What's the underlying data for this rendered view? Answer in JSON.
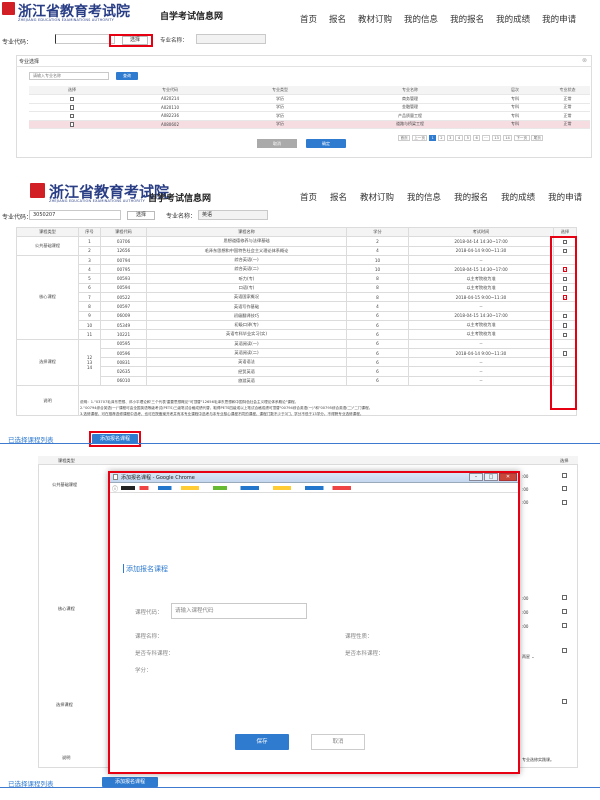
{
  "site": {
    "title": "浙江省教育考试院",
    "subtitle": "ZHEJIANG EDUCATION EXAMINATIONS AUTHORITY",
    "section": "自学考试信息网",
    "nav": [
      "首页",
      "报名",
      "教材订购",
      "我的信息",
      "我的报名",
      "我的成绩",
      "我的申请"
    ]
  },
  "panel1": {
    "major_code_label": "专业代码：",
    "major_code_value": "",
    "choose_btn": "选择",
    "major_name_label": "专业名称：",
    "dialog_title": "专业选择",
    "search_placeholder": "请输入专业名称",
    "search_btn": "查询",
    "headers": [
      "选择",
      "专业代码",
      "专业类型",
      "专业名称",
      "层次",
      "专业状态"
    ],
    "rows": [
      [
        "",
        "A020214",
        "学历",
        "商务管理",
        "专科",
        "正常"
      ],
      [
        "",
        "A020110",
        "学历",
        "金融管理",
        "专科",
        "正常"
      ],
      [
        "",
        "A082236",
        "学历",
        "产品质量工程",
        "专科",
        "正常"
      ],
      [
        "",
        "A080602",
        "学历",
        "道路与桥梁工程",
        "专科",
        "正常"
      ]
    ],
    "pagination": [
      "首页",
      "上一页",
      "1",
      "2",
      "3",
      "4",
      "5",
      "6",
      "···",
      "13",
      "14",
      "下一页",
      "尾页"
    ],
    "cancel_btn": "取消",
    "confirm_btn": "确定"
  },
  "panel2": {
    "major_code_label": "专业代码：",
    "major_code_value": "3050207",
    "choose_btn": "选择",
    "major_name_label": "专业名称：",
    "major_name_value": "英语",
    "headers": [
      "课程类型",
      "序号",
      "课程代码",
      "课程名称",
      "学分",
      "考试时间",
      "选择"
    ],
    "rows": [
      {
        "type": "公共基础课程",
        "seq": "1",
        "code": "03706",
        "name": "思想道德修养与法律基础",
        "credit": "2",
        "time": "2018-04-14 14:30~17:00",
        "sel": "box"
      },
      {
        "type": "",
        "seq": "2",
        "code": "12656",
        "name": "毛泽东思想和中国特色社会主义理论体系概论",
        "credit": "4",
        "time": "2018-04-14 9:00~11:30",
        "sel": "box"
      },
      {
        "type": "",
        "seq": "3",
        "code": "00794",
        "name": "综合英语(一)",
        "credit": "10",
        "time": "--",
        "sel": ""
      },
      {
        "type": "",
        "seq": "4",
        "code": "00795",
        "name": "综合英语(二)",
        "credit": "10",
        "time": "2018-04-15 14:30~17:00",
        "sel": "on"
      },
      {
        "type": "",
        "seq": "5",
        "code": "00593",
        "name": "听力(专)",
        "credit": "8",
        "time": "以主考院校为准",
        "sel": "box"
      },
      {
        "type": "核心课程",
        "seq": "6",
        "code": "00594",
        "name": "口语(专)",
        "credit": "8",
        "time": "以主考院校为准",
        "sel": "box"
      },
      {
        "type": "",
        "seq": "7",
        "code": "00522",
        "name": "英语国家概况",
        "credit": "8",
        "time": "2018-04-15 9:00~11:30",
        "sel": "on"
      },
      {
        "type": "",
        "seq": "8",
        "code": "00597",
        "name": "英语写作基础",
        "credit": "4",
        "time": "--",
        "sel": ""
      },
      {
        "type": "",
        "seq": "9",
        "code": "06009",
        "name": "初级翻译技巧",
        "credit": "6",
        "time": "2018-04-15 14:30~17:00",
        "sel": "box"
      },
      {
        "type": "",
        "seq": "10",
        "code": "05349",
        "name": "初级口译(专)",
        "credit": "6",
        "time": "以主考院校为准",
        "sel": "box"
      },
      {
        "type": "",
        "seq": "11",
        "code": "10221",
        "name": "英语专科毕业实习(实)",
        "credit": "6",
        "time": "以主考院校为准",
        "sel": "box"
      },
      {
        "type": "",
        "seq": "",
        "code": "00595",
        "name": "英语阅读(一)",
        "credit": "6",
        "time": "--",
        "sel": ""
      },
      {
        "type": "",
        "seq": "",
        "code": "00596",
        "name": "英语阅读(二)",
        "credit": "6",
        "time": "2018-04-14 9:00~11:30",
        "sel": "box"
      },
      {
        "type": "选择课程",
        "seq": "",
        "code": "00831",
        "name": "英语语法",
        "credit": "6",
        "time": "--",
        "sel": ""
      },
      {
        "type": "",
        "seq": "",
        "code": "02635",
        "name": "经贸英语",
        "credit": "6",
        "time": "--",
        "sel": ""
      },
      {
        "type": "",
        "seq": "",
        "code": "06010",
        "name": "旅游英语",
        "credit": "6",
        "time": "--",
        "sel": ""
      }
    ],
    "seq_group": "12\n13\n14",
    "note_label": "说明",
    "note_lines": [
      "说明：1.\"03707毛泽东思想、邓小平理论和'三个代表'重要思想概论\"可顶替\"12656毛泽东思想和中国特色社会主义理论体系概论\"课程。",
      "2.\"00794综合英语(一)\"课程可由全国英语等级考试(PETS)三级笔试合格成绩代替，取得PETS四级或以上笔试合格成绩可顶替\"00794综合英语(一)\"和\"00795综合英语(二)\"二门课程。",
      "3.选修课程，可在推荐选修课程中选考，也可在院备案开考并有本专业课程中选考与本专业核心课程不同的课程，课程门数不少于3门，学分不低于13学分。不得跨专业选修课程。"
    ],
    "selected_list": "已选择课程列表",
    "add_btn": "添加报名课程"
  },
  "panel3": {
    "bg_headers": [
      "课程类型",
      "选择"
    ],
    "bg_types": [
      "公共基础课程",
      "核心课程",
      "选择课程",
      "说明"
    ],
    "bg_times": [
      ":00",
      ":00",
      ":00",
      ":00",
      ":00",
      ":00"
    ],
    "bg_note_tail": "专业选修实践课。",
    "bg_select_label": "两星",
    "selected_list": "已选择课程列表",
    "add_btn": "添加报名课程",
    "modal": {
      "window_title": "添加报名课程 - Google Chrome",
      "heading": "添加报名课程",
      "code_label": "课程代码：",
      "code_placeholder": "请输入课程代码",
      "name_label": "课程名称：",
      "nature_label": "课程性质：",
      "specialty_label": "是否专科课程：",
      "undergrad_label": "是否本科课程：",
      "credit_label": "学分：",
      "save_btn": "保存",
      "cancel_btn": "取消"
    }
  },
  "colors": {
    "brand_blue": "#2a3e86",
    "button_blue": "#2f7bd0",
    "highlight_red": "#e60012",
    "row_highlight": "#f6dde2"
  }
}
